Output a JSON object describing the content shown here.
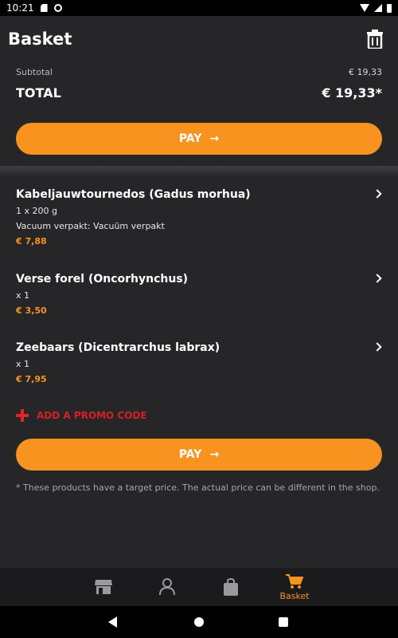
{
  "status_bar": {
    "time": "10:21"
  },
  "header": {
    "title": "Basket",
    "subtotal_label": "Subtotal",
    "subtotal_value": "€ 19,33",
    "total_label": "TOTAL",
    "total_value": "€ 19,33*"
  },
  "pay_button": {
    "label": "PAY",
    "arrow": "→"
  },
  "items": [
    {
      "name": "Kabeljauwtournedos (Gadus morhua)",
      "quantity": "1 x 200 g",
      "option": "Vacuum verpakt: Vacuüm verpakt",
      "price": "€ 7,88"
    },
    {
      "name": "Verse forel (Oncorhynchus)",
      "quantity": "x 1",
      "price": "€ 3,50"
    },
    {
      "name": "Zeebaars (Dicentrarchus labrax)",
      "quantity": "x 1",
      "price": "€ 7,95"
    }
  ],
  "promo": {
    "label": "ADD A PROMO CODE"
  },
  "footnote": "* These products have a target price. The actual price can be different in the shop.",
  "bottom_nav": {
    "basket_label": "Basket"
  },
  "colors": {
    "accent": "#f7931e",
    "promo": "#d61f26",
    "background": "#262628"
  },
  "icons": [
    "trash-icon",
    "chevron-right-icon",
    "plus-icon",
    "store-icon",
    "user-icon",
    "bag-icon",
    "cart-icon"
  ]
}
